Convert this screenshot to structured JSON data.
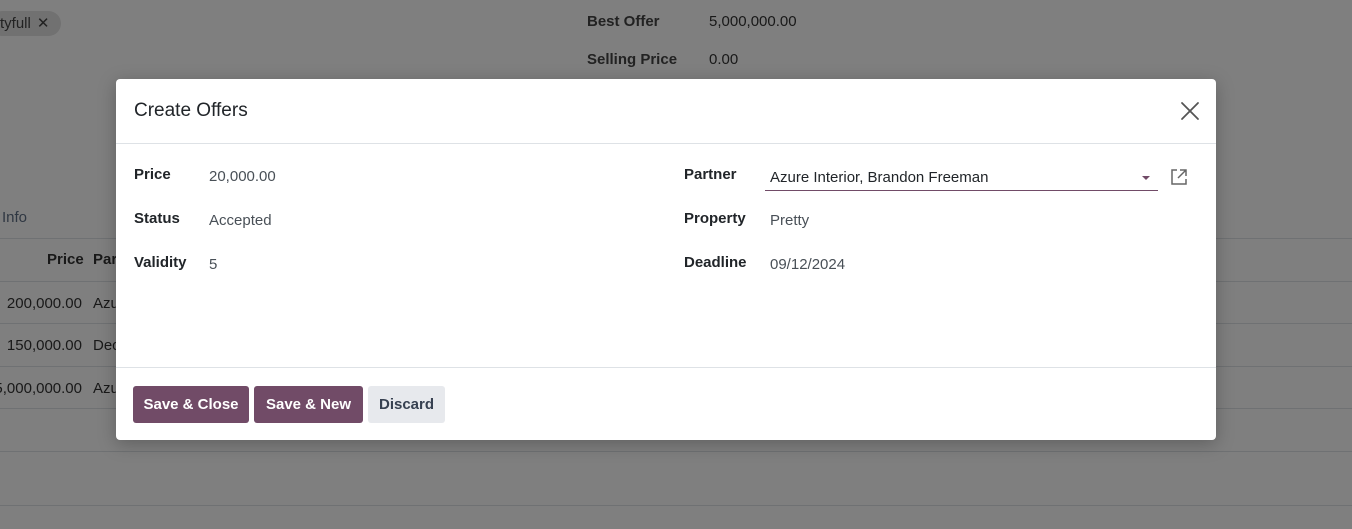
{
  "background": {
    "tag_label": "tyfull",
    "tag_remove": "✕",
    "best_offer_label": "Best Offer",
    "best_offer_value": "5,000,000.00",
    "selling_price_label": "Selling Price",
    "selling_price_value": "0.00",
    "tab_label": "Info",
    "table": {
      "headers": [
        "Price",
        "Par"
      ],
      "rows": [
        {
          "price": "200,000.00",
          "partner": "Azu"
        },
        {
          "price": "150,000.00",
          "partner": "Dec"
        },
        {
          "price": "5,000,000.00",
          "partner": "Azu"
        }
      ]
    }
  },
  "modal": {
    "title": "Create Offers",
    "fields": {
      "price_label": "Price",
      "price_value": "20,000.00",
      "status_label": "Status",
      "status_value": "Accepted",
      "validity_label": "Validity",
      "validity_value": "5",
      "partner_label": "Partner",
      "partner_value": "Azure Interior, Brandon Freeman",
      "property_label": "Property",
      "property_value": "Pretty",
      "deadline_label": "Deadline",
      "deadline_value": "09/12/2024"
    },
    "buttons": {
      "save_close": "Save & Close",
      "save_new": "Save & New",
      "discard": "Discard"
    }
  },
  "colors": {
    "primary": "#714b67",
    "secondary": "#e7e9ed"
  },
  "icons": {
    "close": "close-icon",
    "external_link": "external-link-icon",
    "dropdown": "caret-down-icon"
  }
}
